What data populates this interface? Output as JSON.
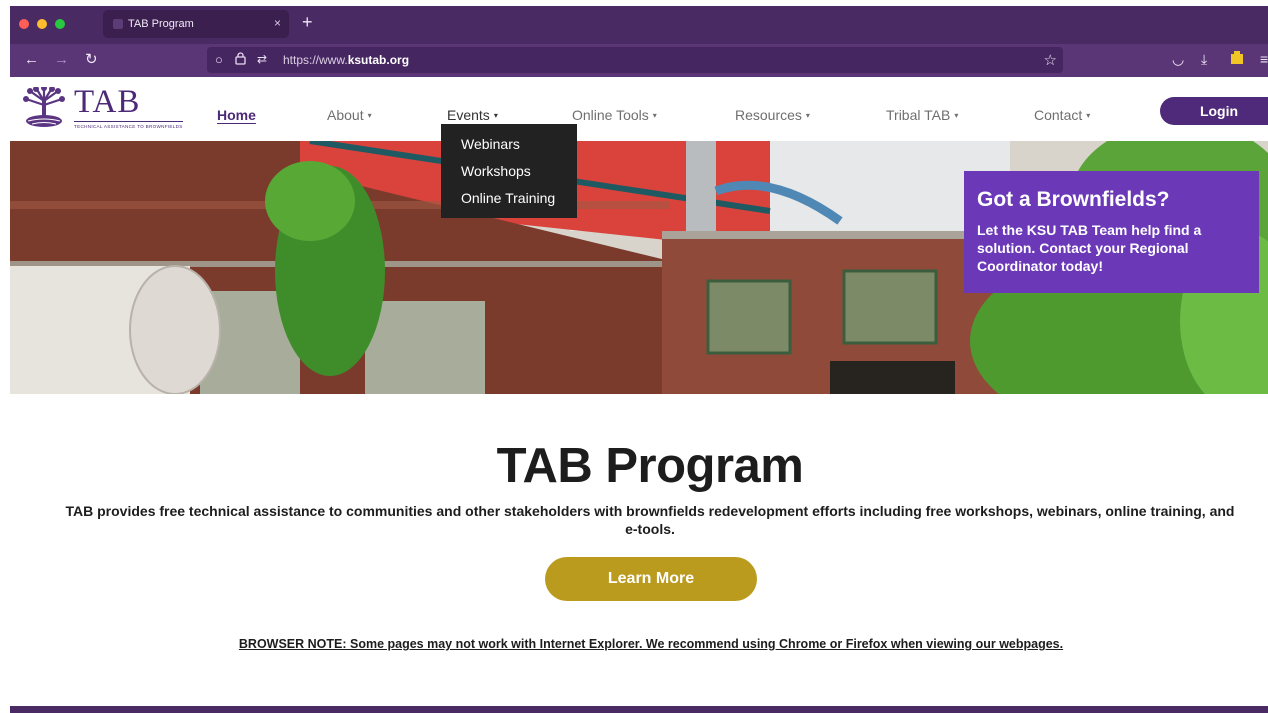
{
  "browser": {
    "tab_title": "TAB Program",
    "tab_close": "×",
    "new_tab": "+",
    "url_prefix": "https://www.",
    "url_domain": "ksutab.org",
    "colors": {
      "chrome": "#4a2a62",
      "urlbar": "#5b3677"
    }
  },
  "site": {
    "logo_text": "TAB",
    "logo_subtext": "TECHNICAL ASSISTANCE TO BROWNFIELDS",
    "nav": [
      {
        "label": "Home",
        "caret": ""
      },
      {
        "label": "About",
        "caret": "▾"
      },
      {
        "label": "Events",
        "caret": "▾"
      },
      {
        "label": "Online Tools",
        "caret": "▾"
      },
      {
        "label": "Resources",
        "caret": "▾"
      },
      {
        "label": "Tribal TAB",
        "caret": "▾"
      },
      {
        "label": "Contact",
        "caret": "▾"
      }
    ],
    "login_label": "Login",
    "events_menu": [
      "Webinars",
      "Workshops",
      "Online Training"
    ]
  },
  "hero": {
    "callout_title": "Got a Brownfields?",
    "callout_text": "Let the KSU TAB Team help find a solution. Contact your Regional Coordinator today!"
  },
  "content": {
    "title": "TAB Program",
    "intro": "TAB provides free technical assistance to communities and other stakeholders with brownfields redevelopment efforts including free workshops, webinars, online training, and e-tools.",
    "learn_more": "Learn More",
    "browser_note": "BROWSER NOTE: Some pages may not work with Internet Explorer. We recommend using Chrome or Firefox when viewing our webpages."
  },
  "colors": {
    "brand_purple": "#4d2a78",
    "callout_purple": "#6b39b8",
    "gold": "#bb9b1e"
  }
}
